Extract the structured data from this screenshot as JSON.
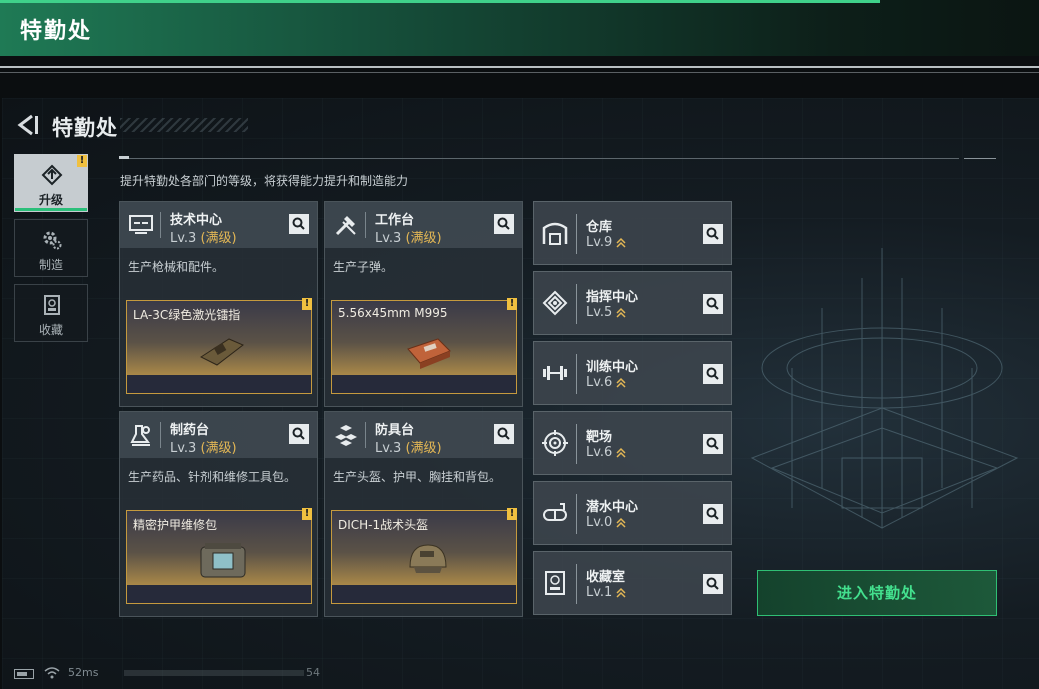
{
  "outer": {
    "title": "特勤处"
  },
  "header": {
    "title": "特勤处"
  },
  "side_tabs": [
    {
      "label": "升级",
      "active": true,
      "alert": "!",
      "icon": "upgrade-icon"
    },
    {
      "label": "制造",
      "active": false,
      "icon": "gear-craft-icon"
    },
    {
      "label": "收藏",
      "active": false,
      "icon": "collection-icon"
    }
  ],
  "subtitle": "提升特勤处各部门的等级，将获得能力提升和制造能力",
  "departments": [
    {
      "name": "技术中心",
      "level": "Lv.3",
      "max": "(满级)",
      "desc": "生产枪械和配件。",
      "item": "LA-3C绿色激光镭指",
      "alert": "!",
      "icon": "tech-center-icon"
    },
    {
      "name": "工作台",
      "level": "Lv.3",
      "max": "(满级)",
      "desc": "生产子弹。",
      "item": "5.56x45mm M995",
      "alert": "!",
      "icon": "workbench-icon"
    },
    {
      "name": "制药台",
      "level": "Lv.3",
      "max": "(满级)",
      "desc": "生产药品、针剂和维修工具包。",
      "item": "精密护甲维修包",
      "alert": "!",
      "icon": "pharmacy-icon"
    },
    {
      "name": "防具台",
      "level": "Lv.3",
      "max": "(满级)",
      "desc": "生产头盔、护甲、胸挂和背包。",
      "item": "DICH-1战术头盔",
      "alert": "!",
      "icon": "armor-bench-icon"
    }
  ],
  "facilities": [
    {
      "name": "仓库",
      "level": "Lv.9",
      "icon": "warehouse-icon"
    },
    {
      "name": "指挥中心",
      "level": "Lv.5",
      "icon": "command-center-icon"
    },
    {
      "name": "训练中心",
      "level": "Lv.6",
      "icon": "training-center-icon"
    },
    {
      "name": "靶场",
      "level": "Lv.6",
      "icon": "shooting-range-icon"
    },
    {
      "name": "潜水中心",
      "level": "Lv.0",
      "icon": "diving-center-icon"
    },
    {
      "name": "收藏室",
      "level": "Lv.1",
      "icon": "collection-room-icon"
    }
  ],
  "enter_button": "进入特勤处",
  "status": {
    "ping": "52ms",
    "fps": "54"
  },
  "colors": {
    "accent_green": "#2fbf74",
    "max_level_gold": "#e3b755",
    "alert_yellow": "#f0c040"
  }
}
